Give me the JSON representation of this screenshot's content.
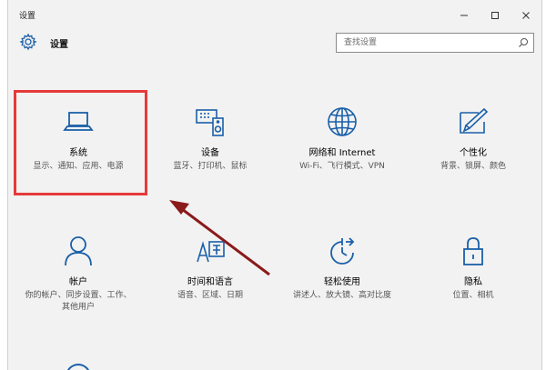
{
  "window": {
    "title": "设置",
    "controls": {
      "minimize": "—",
      "maximize": "☐",
      "close": "✕"
    }
  },
  "header": {
    "title": "设置"
  },
  "search": {
    "placeholder": "查找设置"
  },
  "tiles": [
    {
      "title": "系统",
      "desc": "显示、通知、应用、电源",
      "icon": "laptop-icon"
    },
    {
      "title": "设备",
      "desc": "蓝牙、打印机、鼠标",
      "icon": "devices-icon"
    },
    {
      "title": "网络和 Internet",
      "desc": "Wi-Fi、飞行模式、VPN",
      "icon": "globe-icon"
    },
    {
      "title": "个性化",
      "desc": "背景、锁屏、颜色",
      "icon": "personalize-icon"
    },
    {
      "title": "帐户",
      "desc": "你的帐户、同步设置、工作、其他用户",
      "icon": "person-icon"
    },
    {
      "title": "时间和语言",
      "desc": "语音、区域、日期",
      "icon": "time-language-icon"
    },
    {
      "title": "轻松使用",
      "desc": "讲述人、放大镜、高对比度",
      "icon": "ease-of-access-icon"
    },
    {
      "title": "隐私",
      "desc": "位置、相机",
      "icon": "lock-icon"
    }
  ],
  "colors": {
    "accent": "#1a5fa8",
    "highlight": "#e53a3a",
    "arrow": "#8b1a1a",
    "background": "#f2f2f2"
  }
}
